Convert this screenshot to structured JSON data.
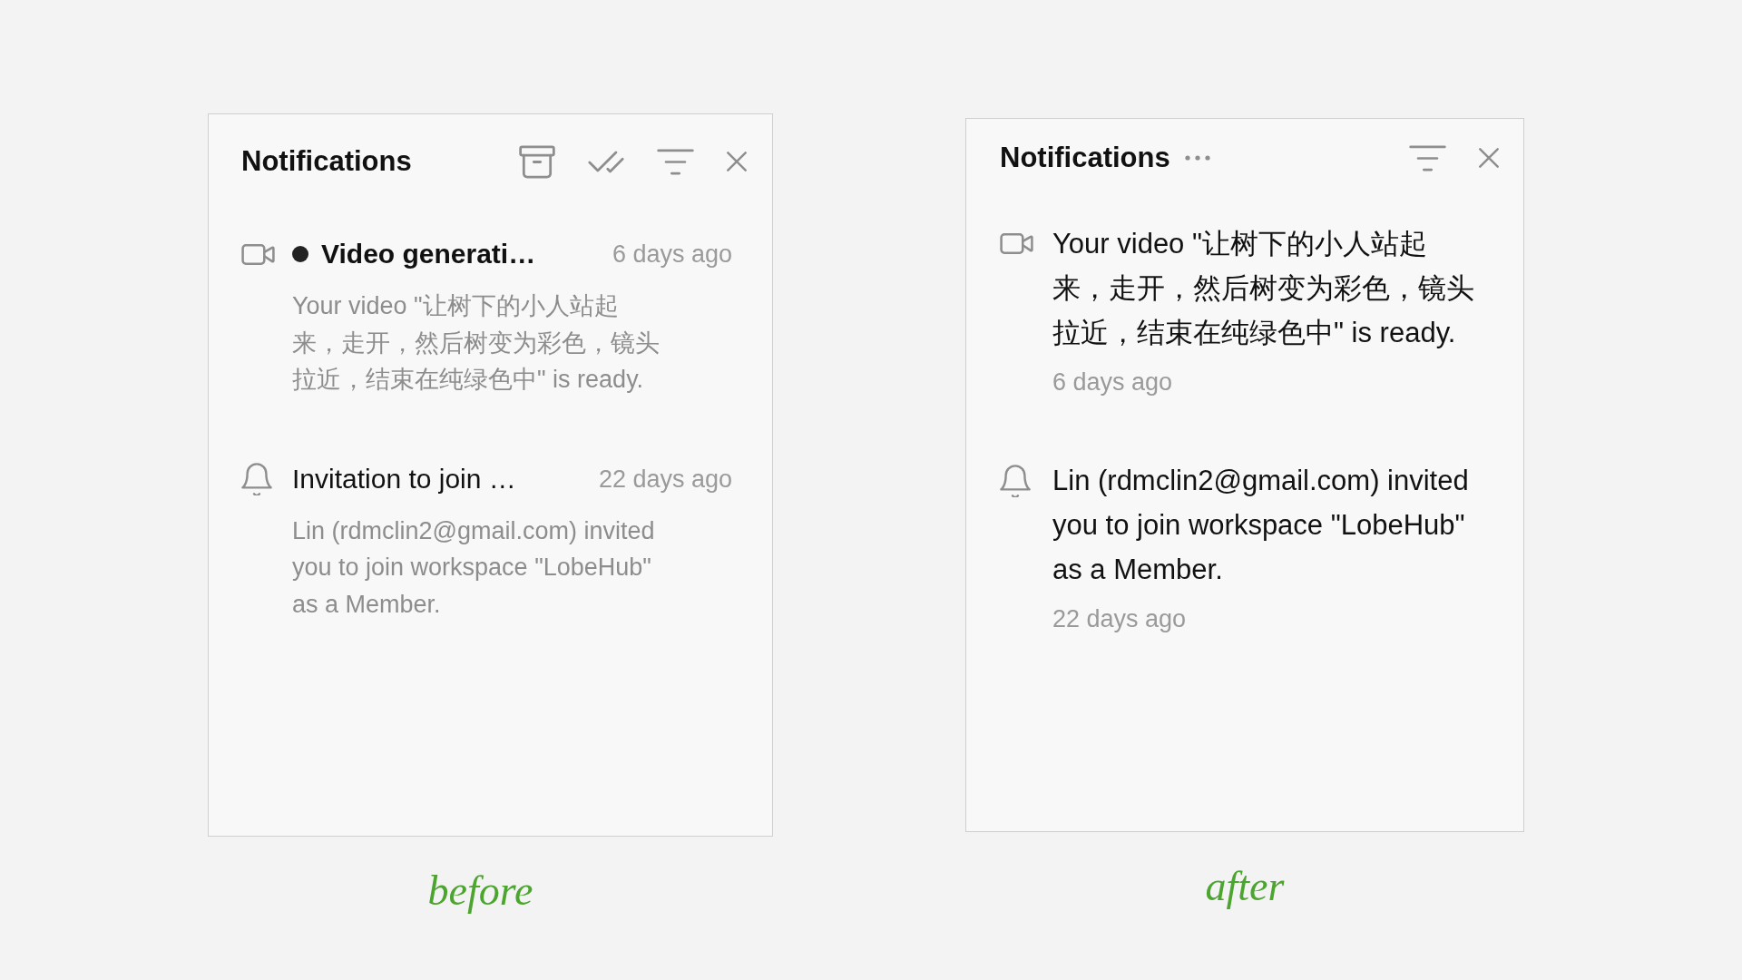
{
  "panels": [
    {
      "kind": "compact",
      "title": "Notifications",
      "actions": [
        {
          "kind": "archive"
        },
        {
          "kind": "mark-read"
        },
        {
          "kind": "filter"
        },
        {
          "kind": "close"
        }
      ],
      "items": [
        {
          "kind": "video",
          "unread": true,
          "title": "Video generati…",
          "time": "6 days ago",
          "body": "Your video \"让树下的小人站起来，走开，然后树变为彩色，镜头拉近，结束在纯绿色中\" is ready."
        },
        {
          "kind": "invite",
          "unread": false,
          "title": "Invitation to join …",
          "time": "22 days ago",
          "body": "Lin (rdmclin2@gmail.com) invited you to join workspace \"LobeHub\" as a Member."
        }
      ],
      "caption": "before"
    },
    {
      "kind": "expanded",
      "title": "Notifications",
      "title_actions": [
        {
          "kind": "more"
        }
      ],
      "actions": [
        {
          "kind": "filter"
        },
        {
          "kind": "close"
        }
      ],
      "items": [
        {
          "kind": "video",
          "body": "Your video \"让树下的小人站起来，走开，然后树变为彩色，镜头拉近，结束在纯绿色中\" is ready.",
          "time": "6 days ago"
        },
        {
          "kind": "invite",
          "body": "Lin (rdmclin2@gmail.com) invited you to join workspace \"LobeHub\" as a Member.",
          "time": "22 days ago"
        }
      ],
      "caption": "after"
    }
  ]
}
